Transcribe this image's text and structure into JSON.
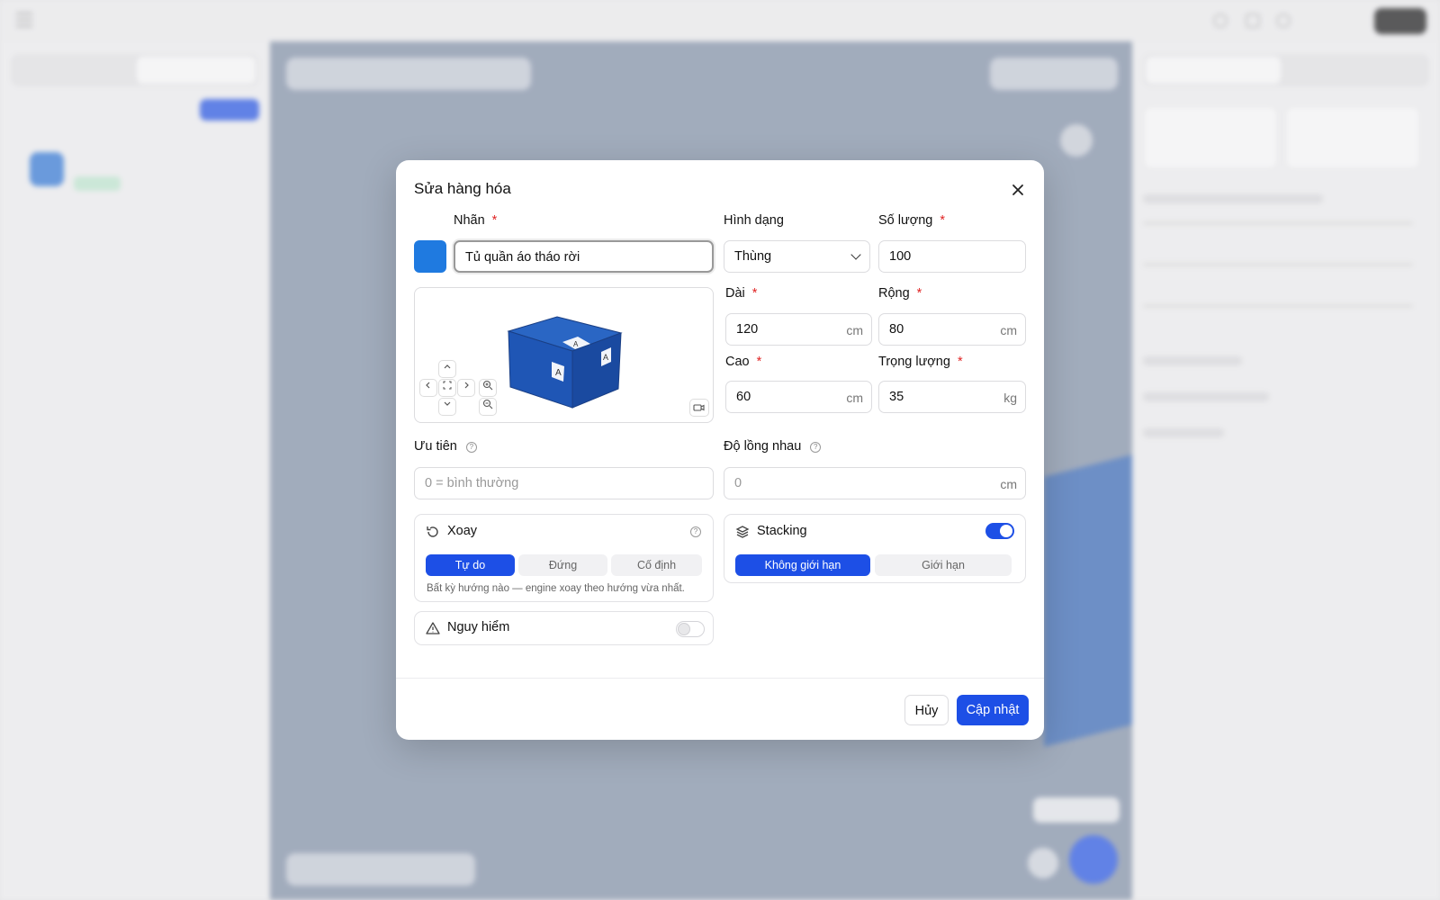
{
  "modal": {
    "title": "Sửa hàng hóa",
    "close_icon": "close-icon",
    "label_field": {
      "label": "Nhãn",
      "value": "Tủ quần áo tháo rời",
      "color": "#1f7ae0"
    },
    "shape_field": {
      "label": "Hình dạng",
      "value": "Thùng"
    },
    "quantity_field": {
      "label": "Số lượng",
      "value": "100"
    },
    "length_field": {
      "label": "Dài",
      "value": "120",
      "unit": "cm"
    },
    "width_field": {
      "label": "Rộng",
      "value": "80",
      "unit": "cm"
    },
    "height_field": {
      "label": "Cao",
      "value": "60",
      "unit": "cm"
    },
    "weight_field": {
      "label": "Trọng lượng",
      "value": "35",
      "unit": "kg"
    },
    "priority_field": {
      "label": "Ưu tiên",
      "placeholder": "0 = bình thường"
    },
    "nesting_field": {
      "label": "Độ lồng nhau",
      "placeholder": "0",
      "unit": "cm"
    },
    "rotation": {
      "title": "Xoay",
      "options": [
        "Tự do",
        "Đứng",
        "Cố định"
      ],
      "selected": "Tự do",
      "hint": "Bất kỳ hướng nào — engine xoay theo hướng vừa nhất."
    },
    "stacking": {
      "title": "Stacking",
      "enabled": true,
      "options": [
        "Không giới hạn",
        "Giới hạn"
      ],
      "selected": "Không giới hạn"
    },
    "hazard": {
      "title": "Nguy hiểm",
      "enabled": false
    },
    "preview": {
      "box_letter": "A"
    },
    "actions": {
      "cancel": "Hủy",
      "submit": "Cập nhật"
    }
  },
  "colors": {
    "accent": "#1d4fe6",
    "required": "#e02424",
    "cargo": "#1f7ae0"
  }
}
